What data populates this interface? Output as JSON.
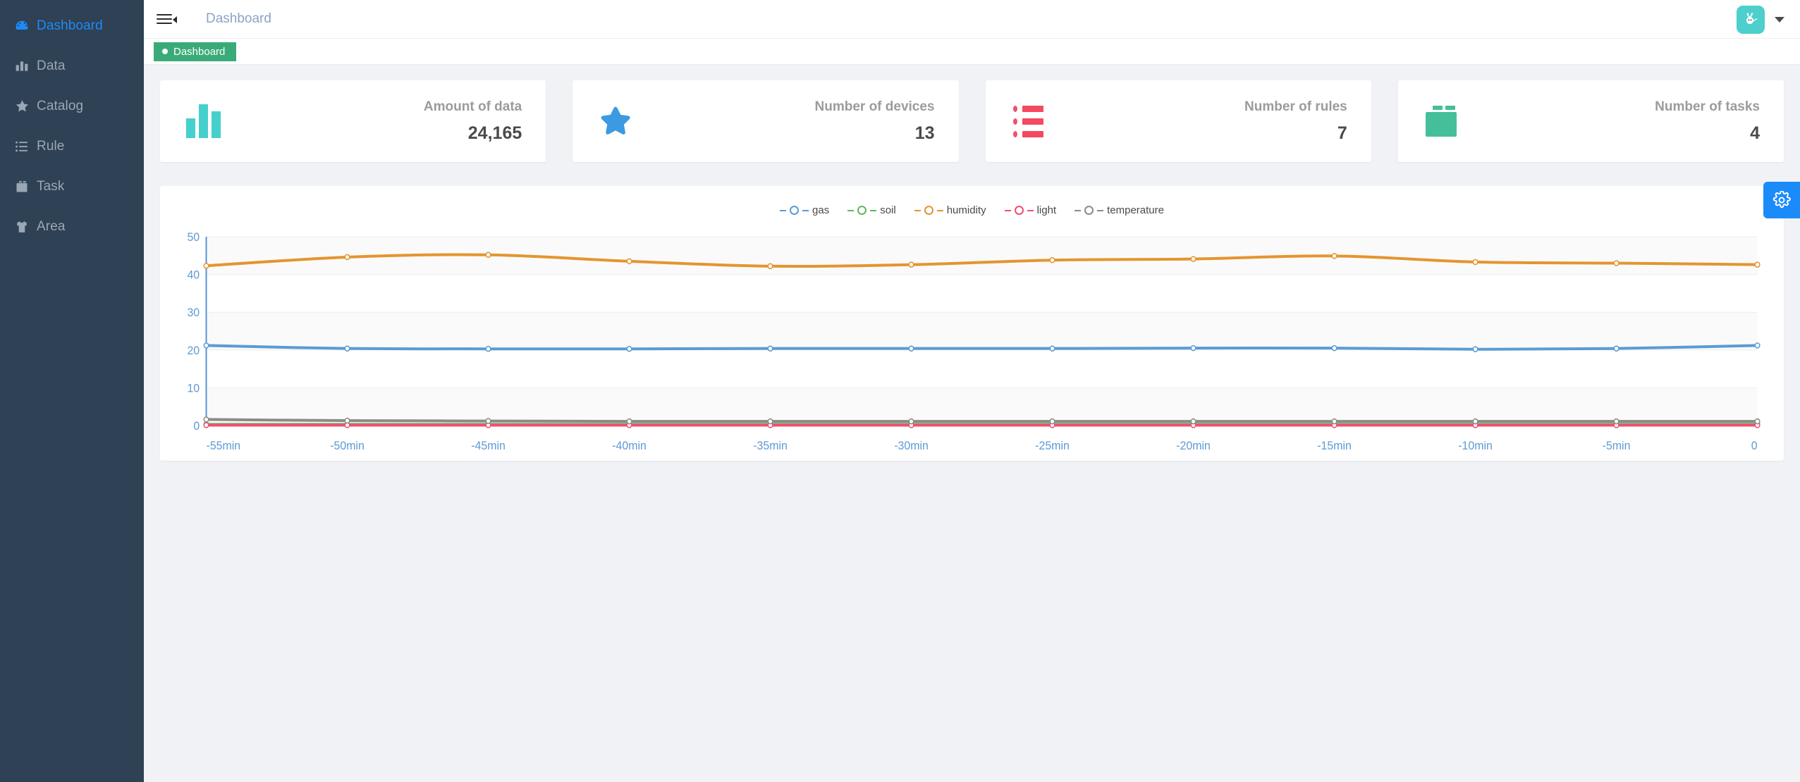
{
  "sidebar": {
    "items": [
      {
        "label": "Dashboard",
        "icon": "dashboard-gauge-icon",
        "active": true
      },
      {
        "label": "Data",
        "icon": "bar-chart-icon",
        "active": false
      },
      {
        "label": "Catalog",
        "icon": "star-icon",
        "active": false
      },
      {
        "label": "Rule",
        "icon": "list-icon",
        "active": false
      },
      {
        "label": "Task",
        "icon": "briefcase-icon",
        "active": false
      },
      {
        "label": "Area",
        "icon": "shirt-icon",
        "active": false
      }
    ]
  },
  "topbar": {
    "title": "Dashboard",
    "menu_toggle_icon": "hamburger-collapse-icon",
    "avatar_icon": "user-avatar-rabbit-icon",
    "avatar_bg": "#4ccfcd",
    "caret_icon": "chevron-down-icon"
  },
  "tabs": [
    {
      "label": "Dashboard",
      "active": true,
      "color": "#3aab78"
    }
  ],
  "stats": [
    {
      "label": "Amount of data",
      "value": "24,165",
      "icon": "bar-chart-icon",
      "color": "#45cfcd"
    },
    {
      "label": "Number of devices",
      "value": "13",
      "icon": "star-icon",
      "color": "#3b9ae1"
    },
    {
      "label": "Number of rules",
      "value": "7",
      "icon": "list-icon",
      "color": "#f4495f"
    },
    {
      "label": "Number of tasks",
      "value": "4",
      "icon": "briefcase-icon",
      "color": "#45bf9a"
    }
  ],
  "floating": {
    "settings_icon": "gear-icon",
    "color": "#1b8bf9"
  },
  "chart_data": {
    "type": "line",
    "title": "",
    "xlabel": "",
    "ylabel": "",
    "ylim": [
      0,
      50
    ],
    "yticks": [
      0,
      10,
      20,
      30,
      40,
      50
    ],
    "grid": true,
    "legend_position": "top-center",
    "categories": [
      "-55min",
      "-50min",
      "-45min",
      "-40min",
      "-35min",
      "-30min",
      "-25min",
      "-20min",
      "-15min",
      "-10min",
      "-5min",
      "0"
    ],
    "series": [
      {
        "name": "gas",
        "color": "#5b9bd5",
        "values": [
          21.2,
          20.4,
          20.3,
          20.3,
          20.4,
          20.4,
          20.4,
          20.5,
          20.5,
          20.2,
          20.4,
          21.2
        ]
      },
      {
        "name": "soil",
        "color": "#5fb85f",
        "values": [
          0.3,
          0.3,
          0.3,
          0.3,
          0.3,
          0.3,
          0.3,
          0.3,
          0.3,
          0.3,
          0.3,
          0.3
        ]
      },
      {
        "name": "humidity",
        "color": "#e4952e",
        "values": [
          42.3,
          44.6,
          45.2,
          43.5,
          42.2,
          42.6,
          43.8,
          44.1,
          44.9,
          43.3,
          43.0,
          42.6
        ]
      },
      {
        "name": "light",
        "color": "#f0506e",
        "values": [
          0.1,
          0.1,
          0.1,
          0.1,
          0.1,
          0.1,
          0.1,
          0.1,
          0.1,
          0.1,
          0.1,
          0.1
        ]
      },
      {
        "name": "temperature",
        "color": "#8a8a8a",
        "values": [
          1.6,
          1.3,
          1.2,
          1.1,
          1.1,
          1.1,
          1.1,
          1.1,
          1.1,
          1.1,
          1.1,
          1.1
        ]
      }
    ]
  }
}
